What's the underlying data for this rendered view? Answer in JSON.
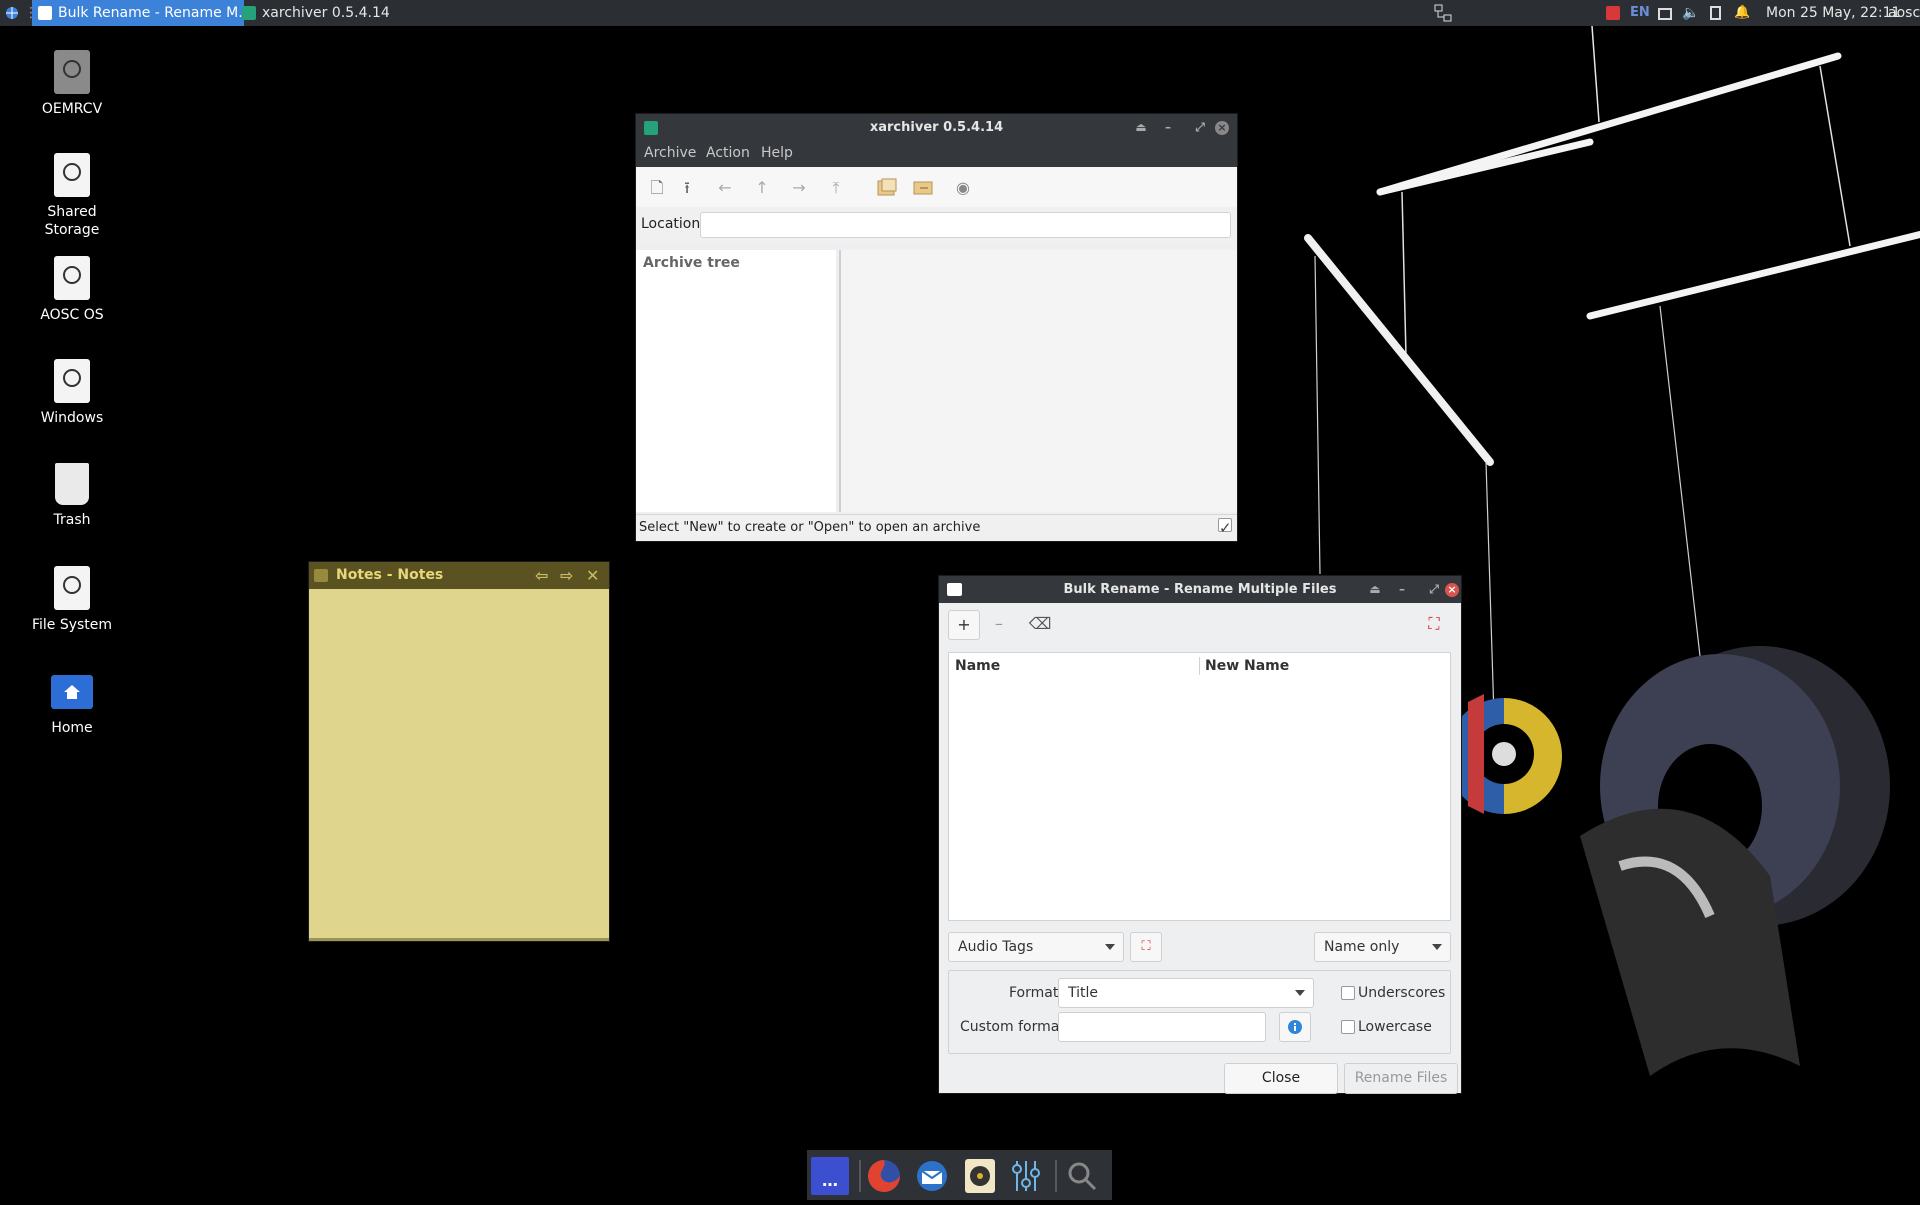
{
  "panel": {
    "tasks": [
      {
        "label": "Bulk Rename - Rename M...",
        "active": true
      },
      {
        "label": "xarchiver 0.5.4.14",
        "active": false
      }
    ],
    "lang": "EN",
    "clock": "Mon 25 May, 22:11",
    "user": "aosc"
  },
  "desktop": {
    "icons": [
      {
        "label": "OEMRCV"
      },
      {
        "label": "Shared Storage"
      },
      {
        "label": "AOSC OS"
      },
      {
        "label": "Windows"
      },
      {
        "label": "Trash"
      },
      {
        "label": "File System"
      },
      {
        "label": "Home"
      }
    ]
  },
  "xarchiver": {
    "title": "xarchiver 0.5.4.14",
    "menu": [
      "Archive",
      "Action",
      "Help"
    ],
    "location_label": "Location:",
    "location_value": "",
    "tree_header": "Archive tree",
    "status": "Select \"New\" to create or \"Open\" to open an archive"
  },
  "notes": {
    "title": "Notes - Notes"
  },
  "bulk": {
    "title": "Bulk Rename - Rename Multiple Files",
    "columns": [
      "Name",
      "New Name"
    ],
    "renamer": "Audio Tags",
    "scope": "Name only",
    "format_label": "Format:",
    "format_value": "Title",
    "custom_format_label": "Custom format:",
    "custom_format_value": "",
    "underscores_label": "Underscores",
    "underscores_checked": false,
    "lowercase_label": "Lowercase",
    "lowercase_checked": false,
    "close_label": "Close",
    "rename_label": "Rename Files"
  },
  "colors": {
    "accent": "#3c82d9",
    "panel": "#2b2e33",
    "titlebar": "#34373c",
    "note_yellow": "#e0d58c"
  }
}
